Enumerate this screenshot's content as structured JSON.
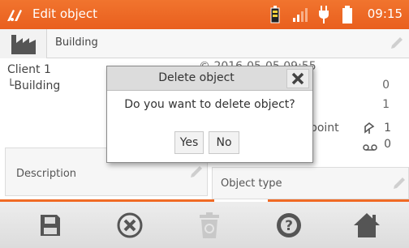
{
  "status_bar": {
    "title": "Edit object",
    "time": "09:15",
    "bg_color": "#ee6a25"
  },
  "object": {
    "name": "Building"
  },
  "tree": {
    "client": "Client 1",
    "building": "└Building"
  },
  "details": {
    "date_partial": "© 2016-05-05 09:55",
    "count_a": "0",
    "count_b": "1",
    "mp_label": "t point",
    "mp_count": "1",
    "rec_count": "0"
  },
  "fields": {
    "description": "Description",
    "object_type": "Object type"
  },
  "dialog": {
    "title": "Delete object",
    "message": "Do you want to delete object?",
    "yes": "Yes",
    "no": "No"
  },
  "toolbar": {
    "icons": [
      "save-icon",
      "cancel-icon",
      "delete-icon",
      "help-icon",
      "home-icon"
    ]
  }
}
